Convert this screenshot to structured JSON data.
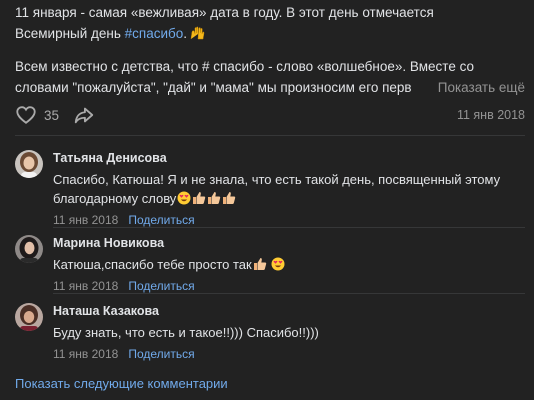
{
  "post": {
    "line1_prefix": "11 января - самая «вежливая» дата в году. В этот день отмечается",
    "line2_prefix": "Всемирный день ",
    "hashtag": "#спасибо",
    "hashtag_suffix": ".",
    "line3": "Всем известно с детства, что # спасибо - слово «волшебное». Вместе со",
    "line4": "словами \"пожалуйста\", \"дай\" и \"мама\" мы произносим его перв",
    "show_more": "Показать ещё",
    "likes": "35",
    "date": "11 янв 2018"
  },
  "comments": [
    {
      "author": "Татьяна Денисова",
      "text1": "Спасибо, Катюша! Я и не знала, что есть такой день, посвященный этому",
      "text2": "благодарному слову",
      "date": "11 янв 2018",
      "share": "Поделиться"
    },
    {
      "author": "Марина Новикова",
      "text1": "Катюша,спасибо тебе просто так",
      "date": "11 янв 2018",
      "share": "Поделиться"
    },
    {
      "author": "Наташа Казакова",
      "text1": "Буду знать, что есть и такое!!))) Спасибо!!)))",
      "date": "11 янв 2018",
      "share": "Поделиться"
    }
  ],
  "more_comments": "Показать следующие комментарии",
  "colors": {
    "background": "#222222",
    "text": "#e1e3e6",
    "link": "#71aaeb",
    "muted": "#939393"
  }
}
